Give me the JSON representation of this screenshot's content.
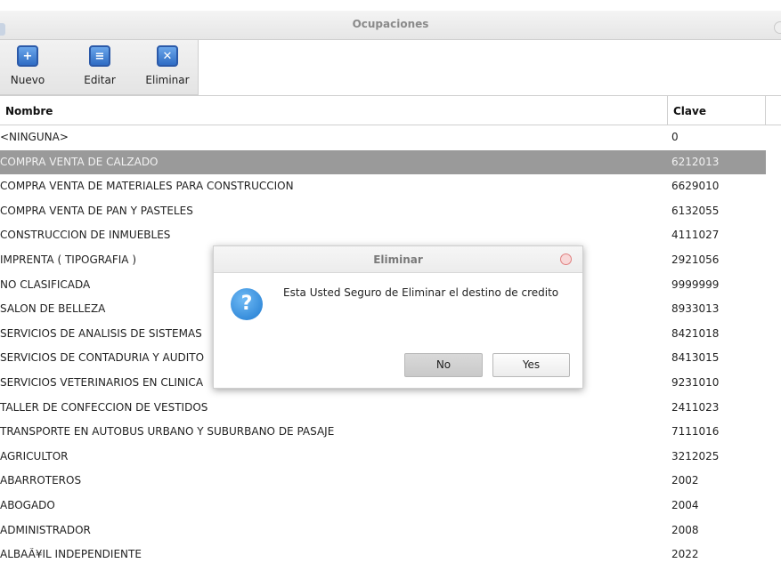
{
  "window": {
    "title": "Ocupaciones"
  },
  "toolbar": {
    "nuevo_label": "Nuevo",
    "editar_label": "Editar",
    "eliminar_label": "Eliminar"
  },
  "table": {
    "headers": {
      "nombre": "Nombre",
      "clave": "Clave"
    },
    "rows": [
      {
        "nombre": "<NINGUNA>",
        "clave": "0"
      },
      {
        "nombre": "COMPRA VENTA DE CALZADO",
        "clave": "6212013"
      },
      {
        "nombre": "COMPRA VENTA DE MATERIALES PARA CONSTRUCCION",
        "clave": "6629010"
      },
      {
        "nombre": "COMPRA VENTA DE PAN Y PASTELES",
        "clave": "6132055"
      },
      {
        "nombre": "CONSTRUCCION DE INMUEBLES",
        "clave": "4111027"
      },
      {
        "nombre": "IMPRENTA ( TIPOGRAFIA )",
        "clave": "2921056"
      },
      {
        "nombre": "NO CLASIFICADA",
        "clave": "9999999"
      },
      {
        "nombre": "SALON DE BELLEZA",
        "clave": "8933013"
      },
      {
        "nombre": "SERVICIOS DE ANALISIS DE SISTEMAS",
        "clave": "8421018"
      },
      {
        "nombre": "SERVICIOS DE CONTADURIA Y AUDITO",
        "clave": "8413015"
      },
      {
        "nombre": "SERVICIOS VETERINARIOS EN CLINICA",
        "clave": "9231010"
      },
      {
        "nombre": "TALLER DE CONFECCION DE VESTIDOS",
        "clave": "2411023"
      },
      {
        "nombre": "TRANSPORTE EN AUTOBUS URBANO Y SUBURBANO DE PASAJE",
        "clave": "7111016"
      },
      {
        "nombre": "AGRICULTOR",
        "clave": "3212025"
      },
      {
        "nombre": "ABARROTEROS",
        "clave": "2002"
      },
      {
        "nombre": "ABOGADO",
        "clave": "2004"
      },
      {
        "nombre": "ADMINISTRADOR",
        "clave": "2008"
      },
      {
        "nombre": "ALBAÃ¥IL INDEPENDIENTE",
        "clave": "2022"
      }
    ]
  },
  "dialog": {
    "title": "Eliminar",
    "message": "Esta Usted Seguro de Eliminar el destino de credito",
    "no_label": "No",
    "yes_label": "Yes"
  }
}
